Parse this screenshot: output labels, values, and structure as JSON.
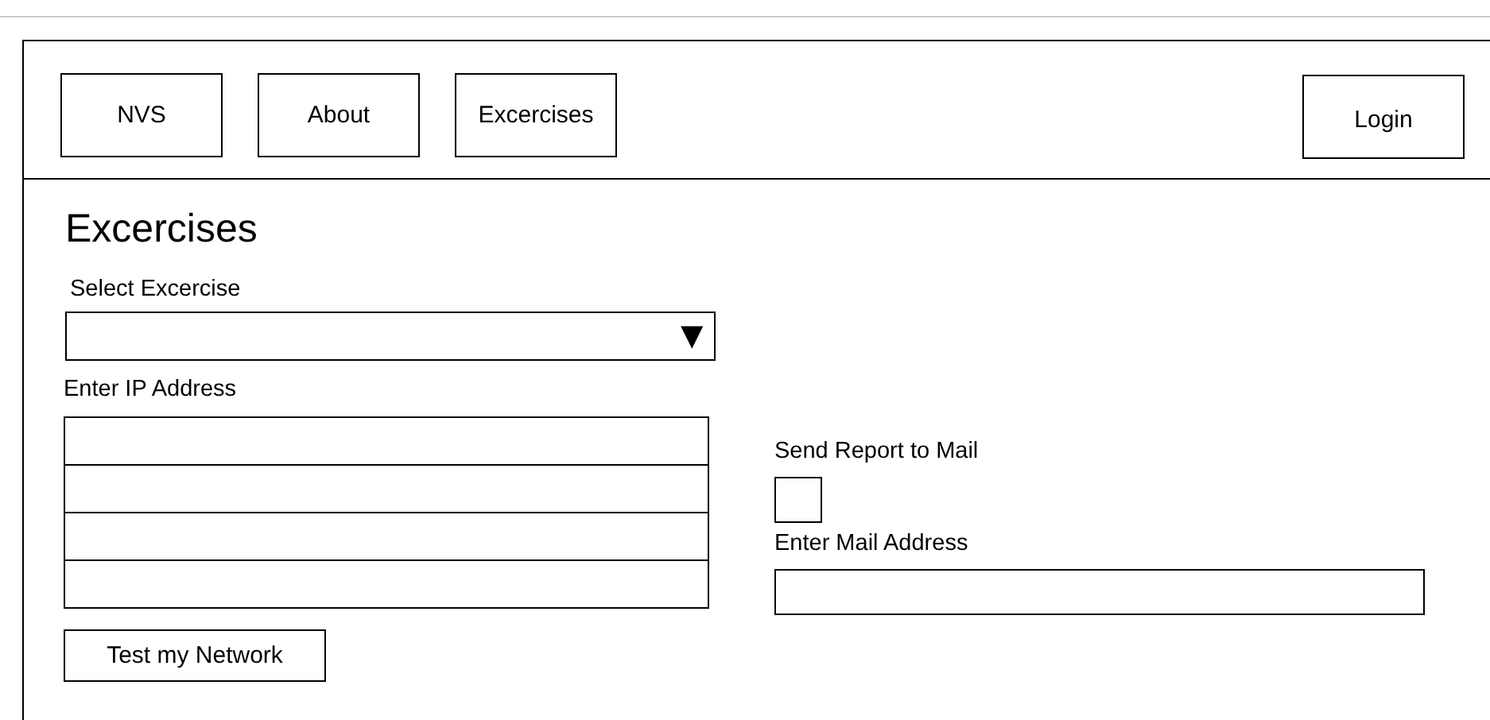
{
  "nav": [
    {
      "label": "NVS"
    },
    {
      "label": "About"
    },
    {
      "label": "Excercises"
    }
  ],
  "login": {
    "label": "Login"
  },
  "heading": "Excercises",
  "select": {
    "label": "Select Excercise",
    "arrow": "▼"
  },
  "ip": {
    "label": "Enter IP Address",
    "fields": [
      {
        "kind": "text"
      },
      {
        "kind": "text"
      },
      {
        "kind": "text"
      },
      {
        "kind": "text"
      }
    ]
  },
  "report": {
    "label": "Send Report to Mail",
    "checked": false
  },
  "mail": {
    "label": "Enter Mail Address"
  },
  "submit": {
    "label": "Test my Network"
  }
}
